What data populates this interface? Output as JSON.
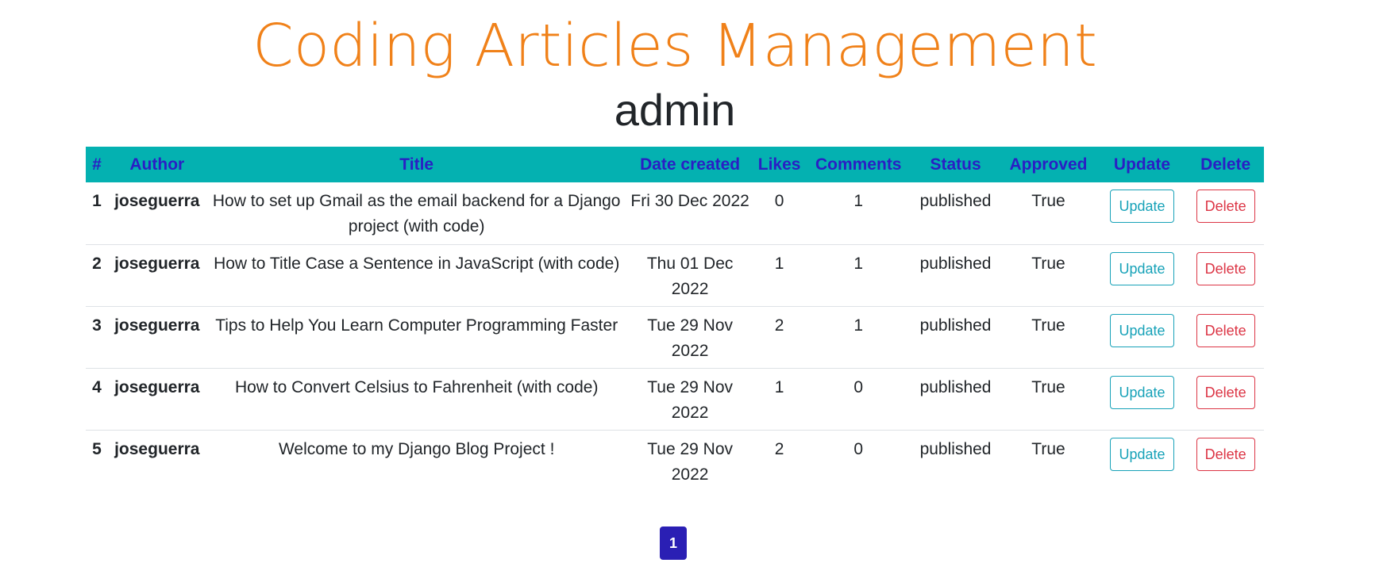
{
  "header": {
    "title": "Coding Articles Management",
    "user": "admin"
  },
  "table": {
    "columns": [
      "#",
      "Author",
      "Title",
      "Date created",
      "Likes",
      "Comments",
      "Status",
      "Approved",
      "Update",
      "Delete"
    ],
    "rows": [
      {
        "num": "1",
        "author": "joseguerra",
        "title": "How to set up Gmail as the email backend for a Django project (with code)",
        "date": "Fri 30 Dec 2022",
        "likes": "0",
        "comments": "1",
        "status": "published",
        "approved": "True",
        "update": "Update",
        "delete": "Delete"
      },
      {
        "num": "2",
        "author": "joseguerra",
        "title": "How to Title Case a Sentence in JavaScript (with code)",
        "date": "Thu 01 Dec 2022",
        "likes": "1",
        "comments": "1",
        "status": "published",
        "approved": "True",
        "update": "Update",
        "delete": "Delete"
      },
      {
        "num": "3",
        "author": "joseguerra",
        "title": "Tips to Help You Learn Computer Programming Faster",
        "date": "Tue 29 Nov 2022",
        "likes": "2",
        "comments": "1",
        "status": "published",
        "approved": "True",
        "update": "Update",
        "delete": "Delete"
      },
      {
        "num": "4",
        "author": "joseguerra",
        "title": "How to Convert Celsius to Fahrenheit (with code)",
        "date": "Tue 29 Nov 2022",
        "likes": "1",
        "comments": "0",
        "status": "published",
        "approved": "True",
        "update": "Update",
        "delete": "Delete"
      },
      {
        "num": "5",
        "author": "joseguerra",
        "title": "Welcome to my Django Blog Project !",
        "date": "Tue 29 Nov 2022",
        "likes": "2",
        "comments": "0",
        "status": "published",
        "approved": "True",
        "update": "Update",
        "delete": "Delete"
      }
    ]
  },
  "pagination": {
    "current_page": "1"
  },
  "colors": {
    "title": "#f08119",
    "header_bg": "#04b1b1",
    "header_text": "#2a1fc4",
    "update": "#17a2b8",
    "delete": "#dc3545",
    "page_active": "#2a1fb4"
  }
}
